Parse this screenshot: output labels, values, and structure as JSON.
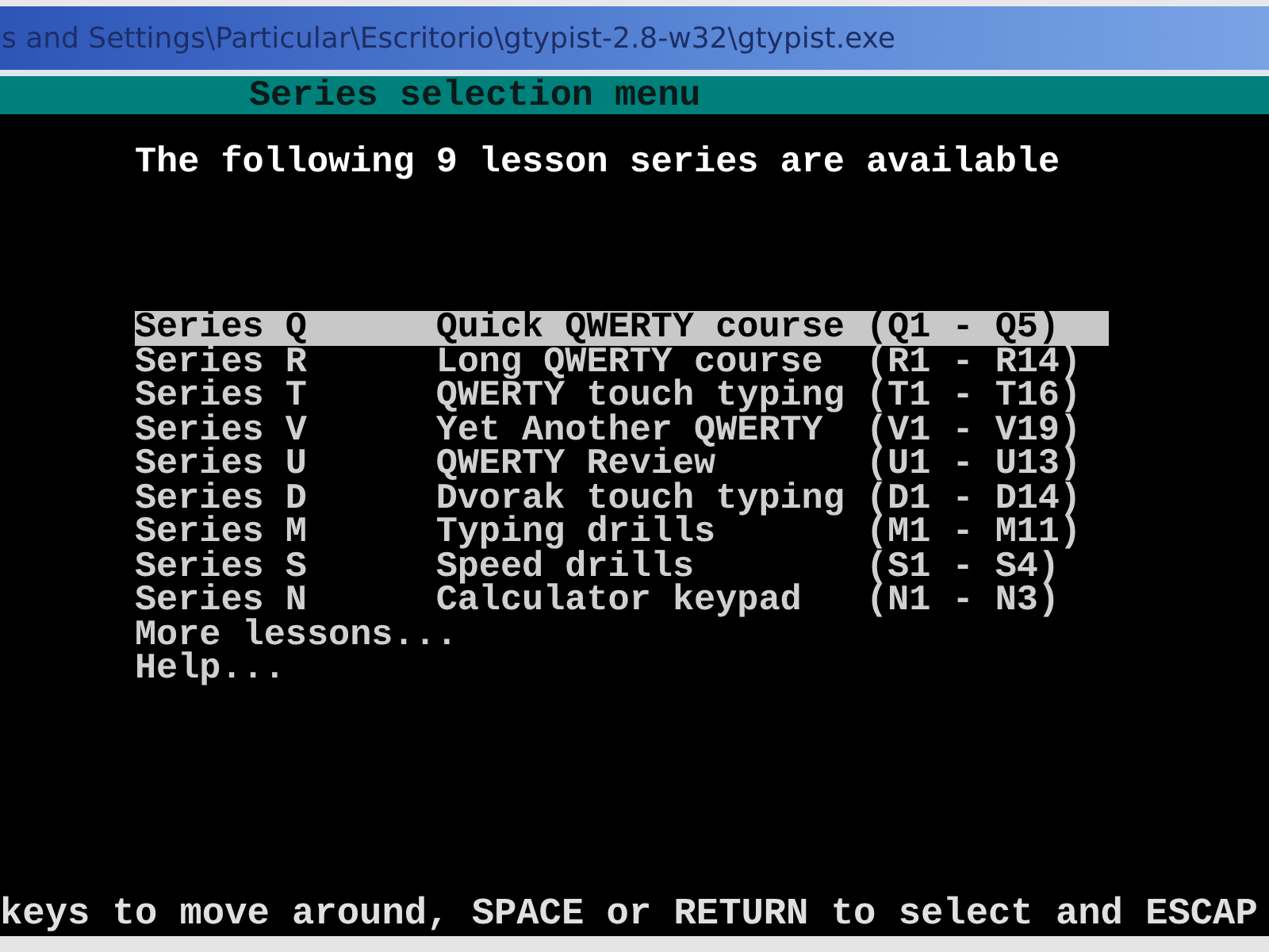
{
  "window": {
    "title": "s and Settings\\Particular\\Escritorio\\gtypist-2.8-w32\\gtypist.exe"
  },
  "header": "Series selection menu",
  "intro": "The following 9 lesson series are available",
  "menu": [
    {
      "kind": "series",
      "label": "Series Q",
      "title": "Quick QWERTY course",
      "range": "(Q1 - Q5)",
      "selected": true
    },
    {
      "kind": "series",
      "label": "Series R",
      "title": "Long QWERTY course",
      "range": "(R1 - R14)",
      "selected": false
    },
    {
      "kind": "series",
      "label": "Series T",
      "title": "QWERTY touch typing",
      "range": "(T1 - T16)",
      "selected": false
    },
    {
      "kind": "series",
      "label": "Series V",
      "title": "Yet Another QWERTY",
      "range": "(V1 - V19)",
      "selected": false
    },
    {
      "kind": "series",
      "label": "Series U",
      "title": "QWERTY Review",
      "range": "(U1 - U13)",
      "selected": false
    },
    {
      "kind": "series",
      "label": "Series D",
      "title": "Dvorak touch typing",
      "range": "(D1 - D14)",
      "selected": false
    },
    {
      "kind": "series",
      "label": "Series M",
      "title": "Typing drills",
      "range": "(M1 - M11)",
      "selected": false
    },
    {
      "kind": "series",
      "label": "Series S",
      "title": "Speed drills",
      "range": "(S1 - S4)",
      "selected": false
    },
    {
      "kind": "series",
      "label": "Series N",
      "title": "Calculator keypad",
      "range": "(N1 - N3)",
      "selected": false
    },
    {
      "kind": "action",
      "label": "More lessons...",
      "selected": false
    },
    {
      "kind": "action",
      "label": "Help...",
      "selected": false
    }
  ],
  "status_line": "keys to move around, SPACE or RETURN to select and ESCAP"
}
